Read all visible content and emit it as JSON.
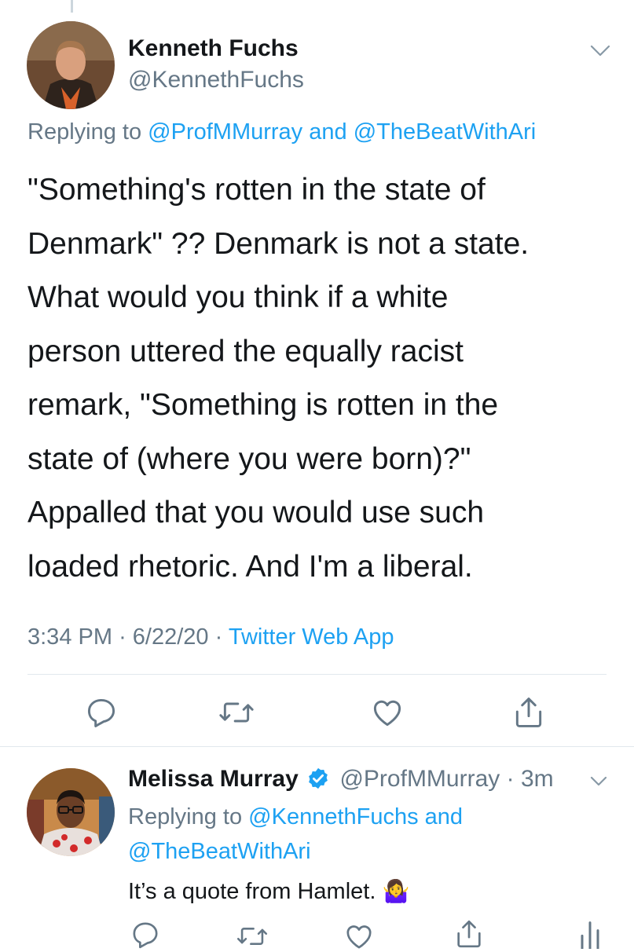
{
  "main_tweet": {
    "author_name": "Kenneth Fuchs",
    "author_handle": "@KennethFuchs",
    "replying_prefix": "Replying to",
    "replying_user_1": "@ProfMMurray",
    "replying_and": "and",
    "replying_user_2": "@TheBeatWithAri",
    "text_lines": [
      "\"Something's rotten in the state of",
      "Denmark\" ?? Denmark is not a state.",
      "What would you think if a white",
      "person uttered the equally racist",
      "remark, \"Something is rotten in the",
      "state of (where you were born)?\"",
      "Appalled that you would use such",
      "loaded rhetoric. And I'm a liberal."
    ],
    "time": "3:34 PM",
    "date": "6/22/20",
    "separator": "·",
    "source": "Twitter Web App"
  },
  "reply_tweet": {
    "author_name": "Melissa Murray",
    "author_handle": "@ProfMMurray",
    "separator": "·",
    "age": "3m",
    "replying_prefix": "Replying to",
    "replying_user_1": "@KennethFuchs",
    "replying_and": "and",
    "replying_user_2": "@TheBeatWithAri",
    "text": "It’s a quote from Hamlet.",
    "emoji": "🤷‍♀️"
  },
  "icons": {
    "reply": "reply-icon",
    "retweet": "retweet-icon",
    "like": "like-icon",
    "share": "share-icon",
    "analytics": "analytics-icon",
    "verified": "verified-badge-icon",
    "more": "chevron-down-icon"
  },
  "colors": {
    "link": "#1da1f2",
    "secondary_text": "#657786",
    "primary_text": "#14171a",
    "divider": "#e1e8ed"
  }
}
